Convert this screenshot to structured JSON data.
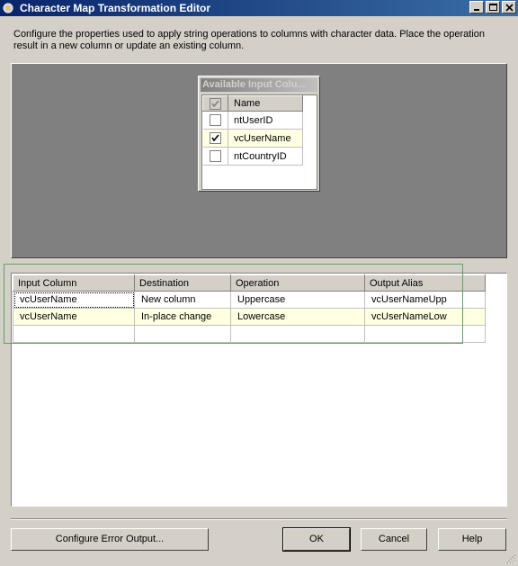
{
  "window": {
    "title": "Character Map Transformation Editor",
    "controls": [
      "minimize",
      "maximize",
      "close"
    ]
  },
  "description": "Configure the properties used to apply string operations to columns with character data. Place the operation result in a new column or update an existing column.",
  "available_columns": {
    "title": "Available Input Colu...",
    "header": "Name",
    "items": [
      {
        "name": "ntUserID",
        "checked": false
      },
      {
        "name": "vcUserName",
        "checked": true
      },
      {
        "name": "ntCountryID",
        "checked": false
      }
    ]
  },
  "grid": {
    "headers": [
      "Input Column",
      "Destination",
      "Operation",
      "Output Alias"
    ],
    "rows": [
      [
        "vcUserName",
        "New column",
        "Uppercase",
        "vcUserNameUpp"
      ],
      [
        "vcUserName",
        "In-place change",
        "Lowercase",
        "vcUserNameLow"
      ],
      [
        "",
        "",
        "",
        ""
      ]
    ]
  },
  "buttons": {
    "configure_error_output": "Configure Error Output...",
    "ok": "OK",
    "cancel": "Cancel",
    "help": "Help"
  },
  "colors": {
    "titlebar_start": "#0a246a",
    "titlebar_end": "#3a6ea5",
    "dialog_bg": "#d4d0c8",
    "row_highlight": "#ffffe1",
    "annotation_border": "#5aa55a"
  }
}
